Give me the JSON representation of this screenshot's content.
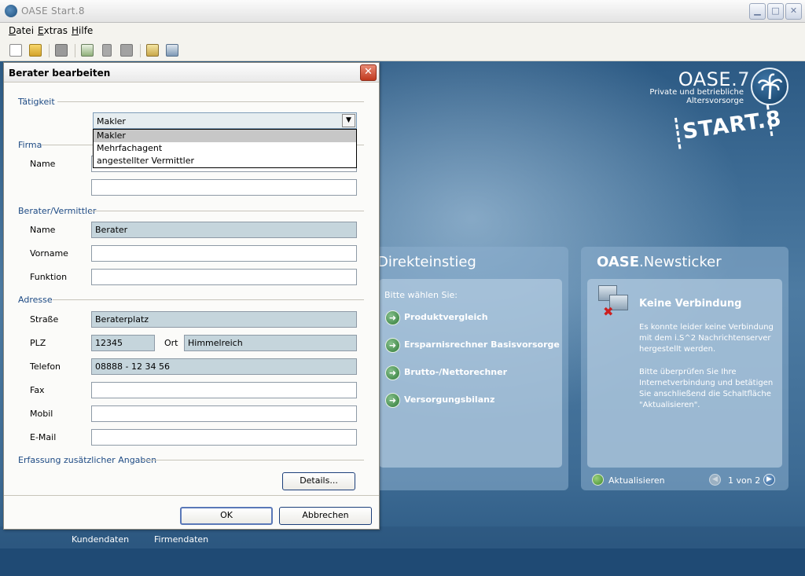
{
  "app": {
    "title": "OASE Start.8",
    "menu": [
      "Datei",
      "Extras",
      "Hilfe"
    ]
  },
  "toolbar": {
    "icons": [
      "new-document-icon",
      "open-folder-icon",
      "save-icon",
      "export-icon",
      "delete-icon",
      "copy-icon",
      "notepad-icon",
      "calculator-icon"
    ]
  },
  "branding": {
    "product": "OASE",
    "version": ".7",
    "subtitle_line1": "Private und betriebliche",
    "subtitle_line2": "Altersvorsorge",
    "start": "START.8"
  },
  "direkteinstieg": {
    "title": "Direkteinstieg",
    "prompt": "Bitte wählen Sie:",
    "links": [
      "Produktvergleich",
      "Ersparnisrechner Basisvorsorge",
      "Brutto-/Nettorechner",
      "Versorgungsbilanz"
    ]
  },
  "newsticker": {
    "title_bold": "OASE",
    "title_rest": ".Newsticker",
    "heading": "Keine Verbindung",
    "text1_l1": "Es konnte leider keine Verbindung",
    "text1_l2": "mit dem i.S^2 Nachrichtenserver",
    "text1_l3": "hergestellt werden.",
    "text2_l1": "Bitte überprüfen Sie Ihre",
    "text2_l2": "Internetverbindung und betätigen",
    "text2_l3": "Sie anschließend die Schaltfläche",
    "text2_l4": "\"Aktualisieren\".",
    "refresh": "Aktualisieren",
    "pager": "1 von 2"
  },
  "bottom_tabs": [
    "Kundendaten",
    "Firmendaten"
  ],
  "dialog": {
    "title": "Berater bearbeiten",
    "sections": {
      "taetigkeit": "Tätigkeit",
      "firma": "Firma",
      "berater": "Berater/Vermittler",
      "adresse": "Adresse",
      "zusatz": "Erfassung zusätzlicher Angaben"
    },
    "taetigkeit": {
      "selected": "Makler",
      "options": [
        "Makler",
        "Mehrfachagent",
        "angestellter Vermittler"
      ]
    },
    "labels": {
      "firma_name": "Name",
      "name": "Name",
      "vorname": "Vorname",
      "funktion": "Funktion",
      "strasse": "Straße",
      "plz": "PLZ",
      "ort": "Ort",
      "telefon": "Telefon",
      "fax": "Fax",
      "mobil": "Mobil",
      "email": "E-Mail"
    },
    "values": {
      "firma_name": "",
      "firma_name2": "",
      "name": "Berater",
      "vorname": "",
      "funktion": "",
      "strasse": "Beraterplatz",
      "plz": "12345",
      "ort": "Himmelreich",
      "telefon": "08888 - 12 34 56",
      "fax": "",
      "mobil": "",
      "email": ""
    },
    "buttons": {
      "details": "Details...",
      "ok": "OK",
      "cancel": "Abbrechen"
    }
  }
}
